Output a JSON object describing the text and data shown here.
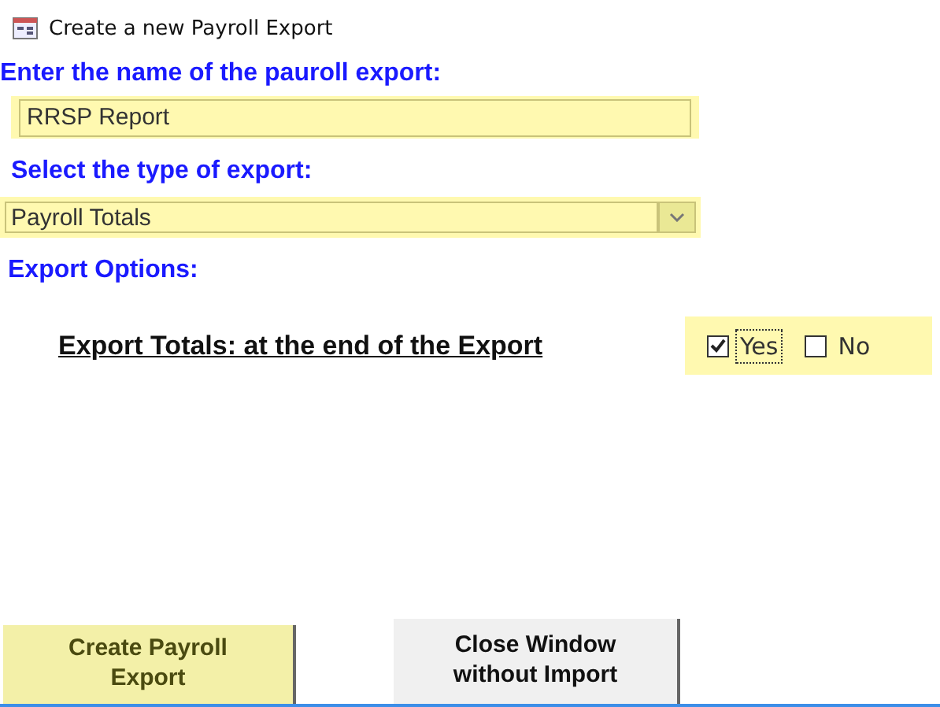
{
  "window": {
    "title": "Create a new Payroll Export"
  },
  "name_section": {
    "label": "Enter the name of the pauroll export:",
    "value": "RRSP Report"
  },
  "type_section": {
    "label": "Select  the type of export:",
    "value": "Payroll Totals"
  },
  "options_section": {
    "label": "Export Options:",
    "question": "Export Totals: at the end of the Export",
    "choices": [
      {
        "label": "Yes",
        "checked": true,
        "focused": true
      },
      {
        "label": "No",
        "checked": false,
        "focused": false
      }
    ]
  },
  "buttons": [
    {
      "label": "Create Payroll Export",
      "kind": "primary"
    },
    {
      "label": "Close Window without Import",
      "kind": "secondary"
    }
  ]
}
